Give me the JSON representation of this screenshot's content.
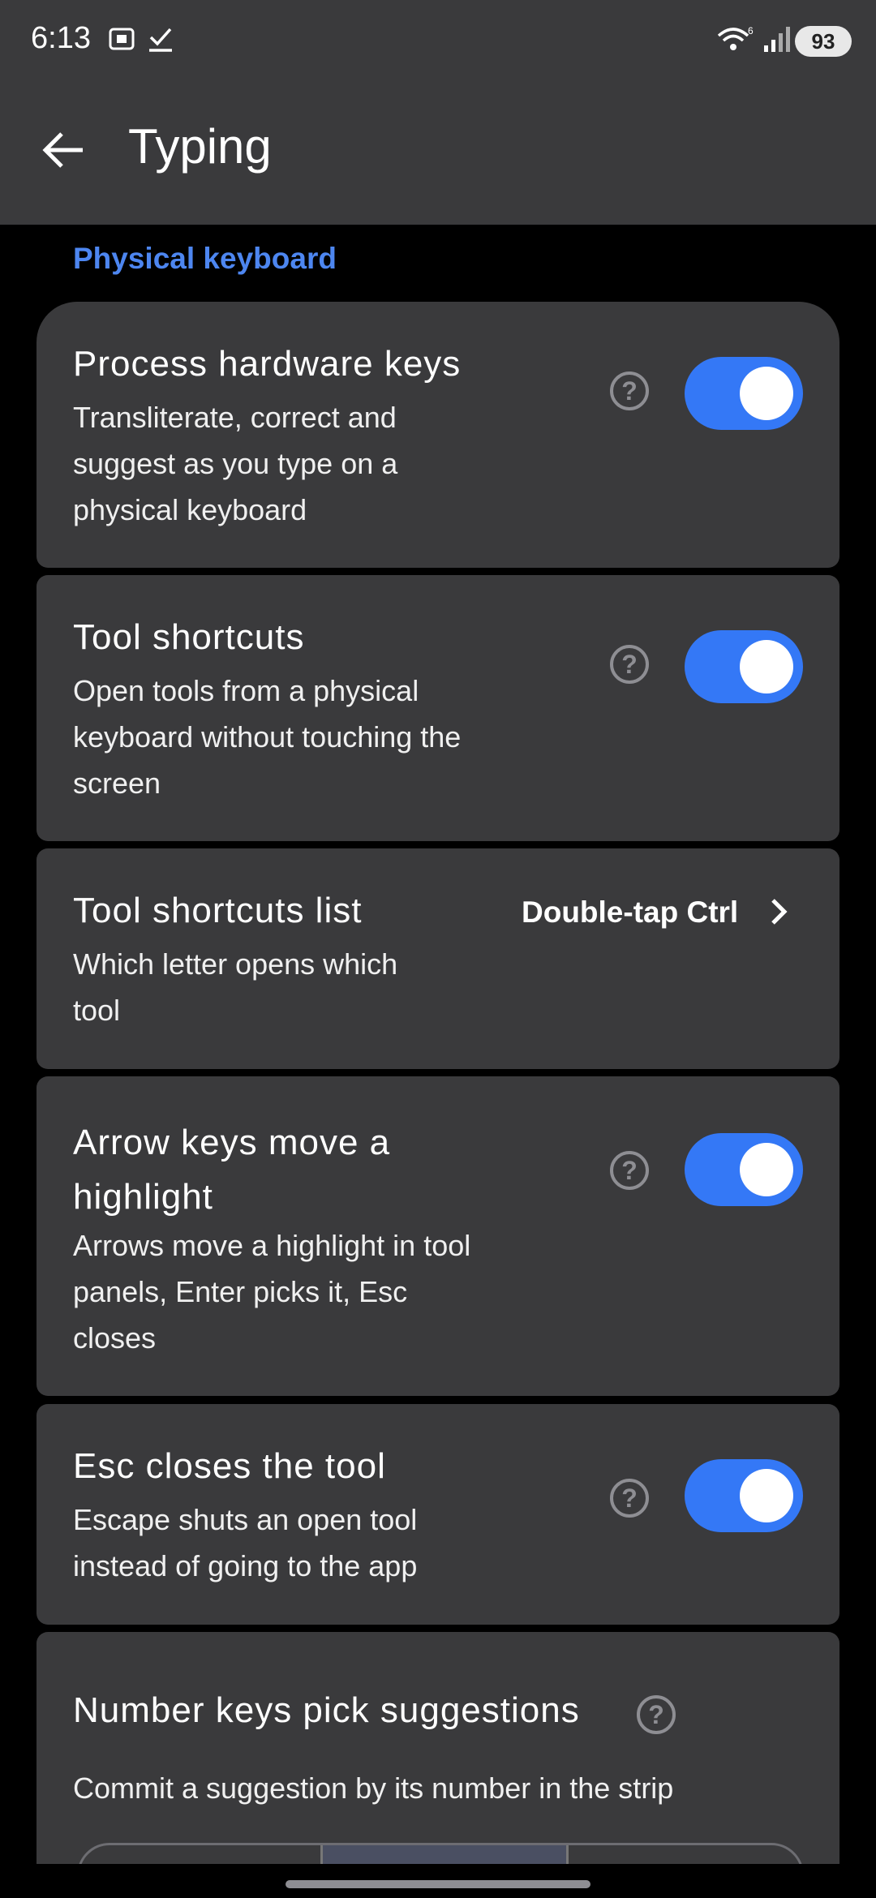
{
  "status_bar": {
    "time": "6:13",
    "battery": "93",
    "icons": [
      "screenshot-icon",
      "task-done-icon",
      "wifi-icon",
      "signal-icon"
    ]
  },
  "app_bar": {
    "title": "Typing",
    "back_icon": "arrow-left-icon"
  },
  "section_header": "Physical keyboard",
  "settings": [
    {
      "title": "Process hardware keys",
      "desc_lines": [
        "Transliterate, correct and",
        "suggest as you type on a",
        "physical keyboard"
      ],
      "toggle_on": true
    },
    {
      "title": "Tool shortcuts",
      "desc_lines": [
        "Open tools from a physical",
        "keyboard without touching the",
        "screen"
      ],
      "toggle_on": true
    },
    {
      "title": "Tool shortcuts list",
      "desc_lines": [
        "Which letter opens which",
        "tool"
      ],
      "value": "Double-tap Ctrl"
    },
    {
      "title_lines": [
        "Arrow keys move a",
        "highlight"
      ],
      "desc_lines": [
        "Arrows move a highlight in tool",
        "panels, Enter picks it, Esc",
        "closes"
      ],
      "toggle_on": true
    },
    {
      "title": "Esc closes the tool",
      "desc_lines": [
        "Escape shuts an open tool",
        "instead of going to the app"
      ],
      "toggle_on": true
    },
    {
      "title": "Number keys pick suggestions",
      "desc_lines": [
        "Commit a suggestion by its number in the strip"
      ]
    }
  ],
  "colors": {
    "accent": "#3478f6",
    "section": "#4d86f0",
    "card": "#3a3a3c",
    "background": "#000000"
  }
}
